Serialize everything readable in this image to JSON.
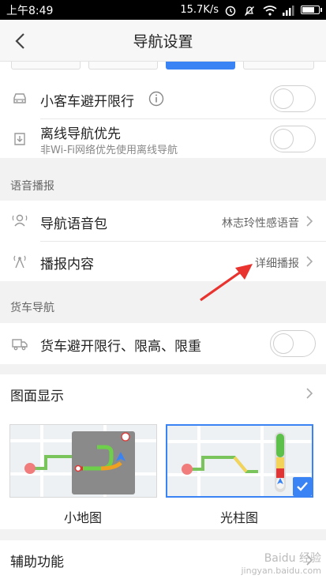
{
  "statusbar": {
    "time": "上午8:49",
    "speed": "15.7K/s"
  },
  "header": {
    "title": "导航设置"
  },
  "car": {
    "avoid_limit_label": "小客车避开限行",
    "offline_label": "离线导航优先",
    "offline_sub": "非Wi-Fi网络优先使用离线导航",
    "avoid_limit_on": false,
    "offline_on": false
  },
  "voice": {
    "section_label": "语音播报",
    "pack_label": "导航语音包",
    "pack_value": "林志玲性感语音",
    "content_label": "播报内容",
    "content_value": "详细播报"
  },
  "truck": {
    "section_label": "货车导航",
    "avoid_label": "货车避开限行、限高、限重",
    "avoid_on": false
  },
  "display": {
    "label": "图面显示",
    "options": [
      {
        "caption": "小地图",
        "selected": false
      },
      {
        "caption": "光柱图",
        "selected": true
      }
    ]
  },
  "assist": {
    "label": "辅助功能"
  },
  "watermark": {
    "line1": "Baidu 经验",
    "line2": "jingyan.baidu.com"
  },
  "colors": {
    "accent": "#3a83f5",
    "annotation": "#e8332f"
  }
}
